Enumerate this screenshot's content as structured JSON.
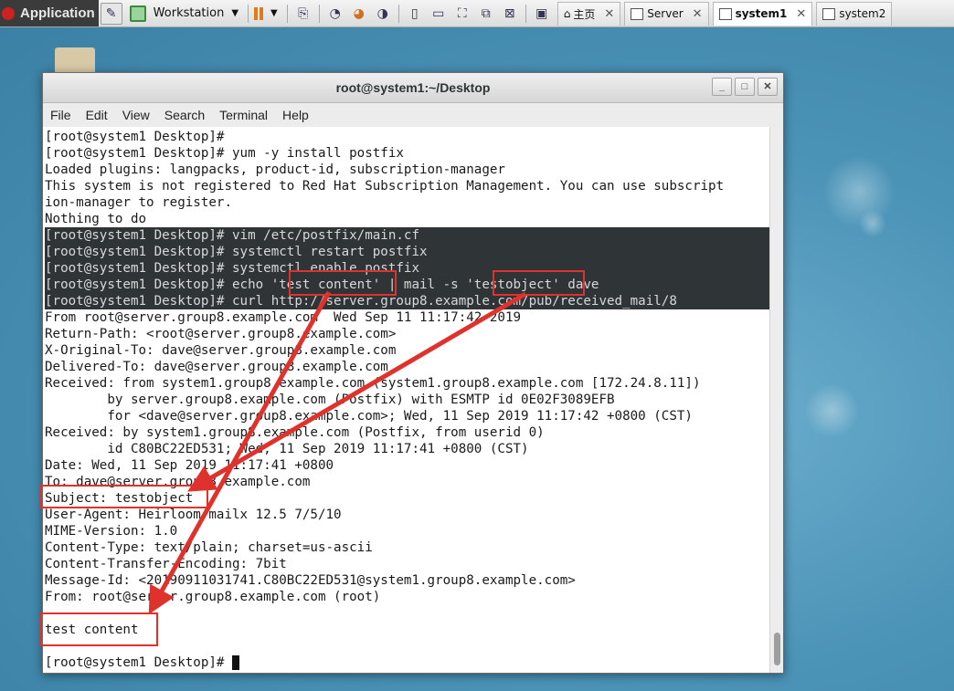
{
  "toolbar": {
    "app_label": "Application",
    "workstation_label": "Workstation",
    "tabs": [
      {
        "label": "主页"
      },
      {
        "label": "Server"
      },
      {
        "label": "system1"
      },
      {
        "label": "system2"
      }
    ]
  },
  "window": {
    "title": "root@system1:~/Desktop",
    "menu": [
      "File",
      "Edit",
      "Search",
      "Terminal",
      "Help",
      "View"
    ]
  },
  "terminal": {
    "lines": [
      "[root@system1 Desktop]#",
      "[root@system1 Desktop]# yum -y install postfix",
      "Loaded plugins: langpacks, product-id, subscription-manager",
      "This system is not registered to Red Hat Subscription Management. You can use subscript",
      "ion-manager to register.",
      "Nothing to do",
      "[root@system1 Desktop]# vim /etc/postfix/main.cf",
      "[root@system1 Desktop]# systemctl restart postfix",
      "[root@system1 Desktop]# systemctl enable postfix",
      "[root@system1 Desktop]# echo 'test content' | mail -s 'testobject' dave",
      "[root@system1 Desktop]# curl http://server.group8.example.com/pub/received_mail/8",
      "From root@server.group8.example.com  Wed Sep 11 11:17:42 2019",
      "Return-Path: <root@server.group8.example.com>",
      "X-Original-To: dave@server.group8.example.com",
      "Delivered-To: dave@server.group8.example.com",
      "Received: from system1.group8.example.com (system1.group8.example.com [172.24.8.11])",
      "        by server.group8.example.com (Postfix) with ESMTP id 0E02F3089EFB",
      "        for <dave@server.group8.example.com>; Wed, 11 Sep 2019 11:17:42 +0800 (CST)",
      "Received: by system1.group8.example.com (Postfix, from userid 0)",
      "        id C80BC22ED531; Wed, 11 Sep 2019 11:17:41 +0800 (CST)",
      "Date: Wed, 11 Sep 2019 11:17:41 +0800",
      "To: dave@server.group8.example.com",
      "Subject: testobject",
      "User-Agent: Heirloom mailx 12.5 7/5/10",
      "MIME-Version: 1.0",
      "Content-Type: text/plain; charset=us-ascii",
      "Content-Transfer-Encoding: 7bit",
      "Message-Id: <20190911031741.C80BC22ED531@system1.group8.example.com>",
      "From: root@server.group8.example.com (root)",
      "",
      "test content",
      "",
      "[root@system1 Desktop]# "
    ],
    "selected_lines": [
      6,
      7,
      8,
      9,
      10
    ]
  },
  "annotation_color": "#e0322c"
}
